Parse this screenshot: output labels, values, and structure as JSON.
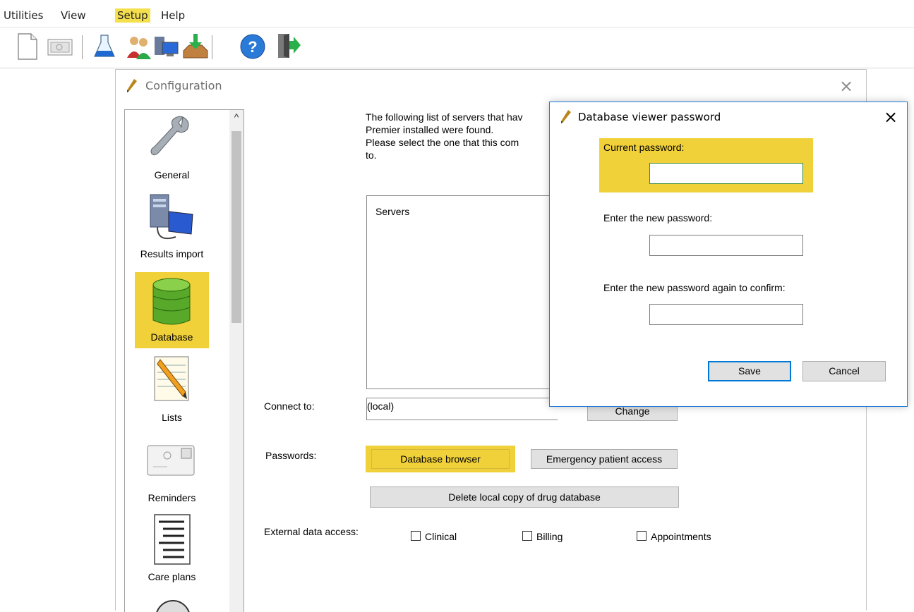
{
  "menubar": {
    "items": [
      {
        "label": "Utilities",
        "highlighted": false
      },
      {
        "label": "View",
        "highlighted": false
      },
      {
        "label": "Setup",
        "highlighted": true
      },
      {
        "label": "Help",
        "highlighted": false
      }
    ]
  },
  "toolbar": {
    "icons": [
      "new-document-icon",
      "letter-icon",
      "flask-icon",
      "users-icon",
      "computers-icon",
      "inbox-download-icon",
      "help-icon",
      "exit-door-icon"
    ]
  },
  "config_window": {
    "title": "Configuration",
    "close_glyph": "×",
    "nav": {
      "scroll_up_glyph": "^",
      "items": [
        {
          "label": "General",
          "icon": "wrench-icon",
          "selected": false
        },
        {
          "label": "Results import",
          "icon": "server-pc-icon",
          "selected": false
        },
        {
          "label": "Database",
          "icon": "database-icon",
          "selected": true
        },
        {
          "label": "Lists",
          "icon": "notepad-pencil-icon",
          "selected": false
        },
        {
          "label": "Reminders",
          "icon": "envelope-icon",
          "selected": false
        },
        {
          "label": "Care plans",
          "icon": "document-list-icon",
          "selected": false
        }
      ]
    },
    "intro_lines": [
      "The following list of servers that hav",
      "Premier installed were found.",
      "Please select the one that this com",
      "to."
    ],
    "servers_header": "Servers",
    "connect_to_label": "Connect to:",
    "connect_to_value": "(local)",
    "change_button": "Change",
    "passwords_label": "Passwords:",
    "database_browser_button": "Database browser",
    "emergency_button": "Emergency patient access",
    "delete_drug_db_button": "Delete local copy of drug database",
    "external_label": "External data access:",
    "checkboxes": [
      {
        "label": "Clinical",
        "checked": false
      },
      {
        "label": "Billing",
        "checked": false
      },
      {
        "label": "Appointments",
        "checked": false
      }
    ]
  },
  "password_dialog": {
    "title": "Database viewer password",
    "close_glyph": "×",
    "current_label": "Current password:",
    "current_value": "",
    "new_label": "Enter the new password:",
    "new_value": "",
    "confirm_label": "Enter the new password again to confirm:",
    "confirm_value": "",
    "save_button": "Save",
    "cancel_button": "Cancel"
  },
  "colors": {
    "highlight": "#f1d13a",
    "dialog_border": "#1f7bd8",
    "default_button_border": "#0078d7"
  }
}
